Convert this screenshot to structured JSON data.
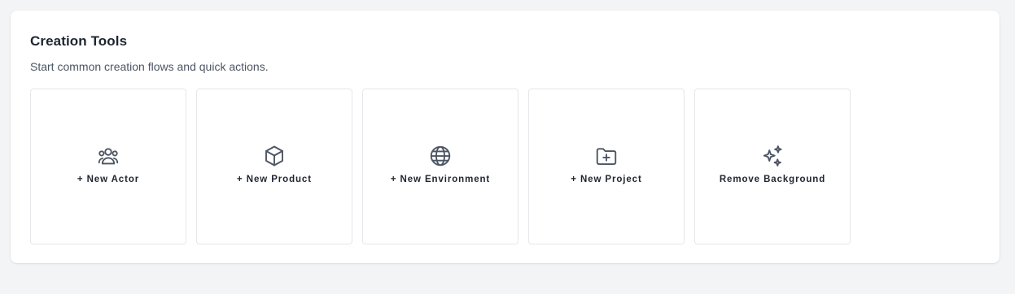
{
  "section": {
    "title": "Creation Tools",
    "subtitle": "Start common creation flows and quick actions."
  },
  "tiles": [
    {
      "label": "+ New Actor",
      "icon": "users-icon"
    },
    {
      "label": "+ New Product",
      "icon": "box-icon"
    },
    {
      "label": "+ New Environment",
      "icon": "globe-icon"
    },
    {
      "label": "+ New Project",
      "icon": "folder-plus-icon"
    },
    {
      "label": "Remove Background",
      "icon": "sparkles-icon"
    }
  ],
  "colors": {
    "page_background": "#f3f4f6",
    "panel_background": "#ffffff",
    "tile_border": "#e5e7eb",
    "text_primary": "#1f2530",
    "text_secondary": "#4b5563",
    "icon_stroke": "#4b5563"
  }
}
